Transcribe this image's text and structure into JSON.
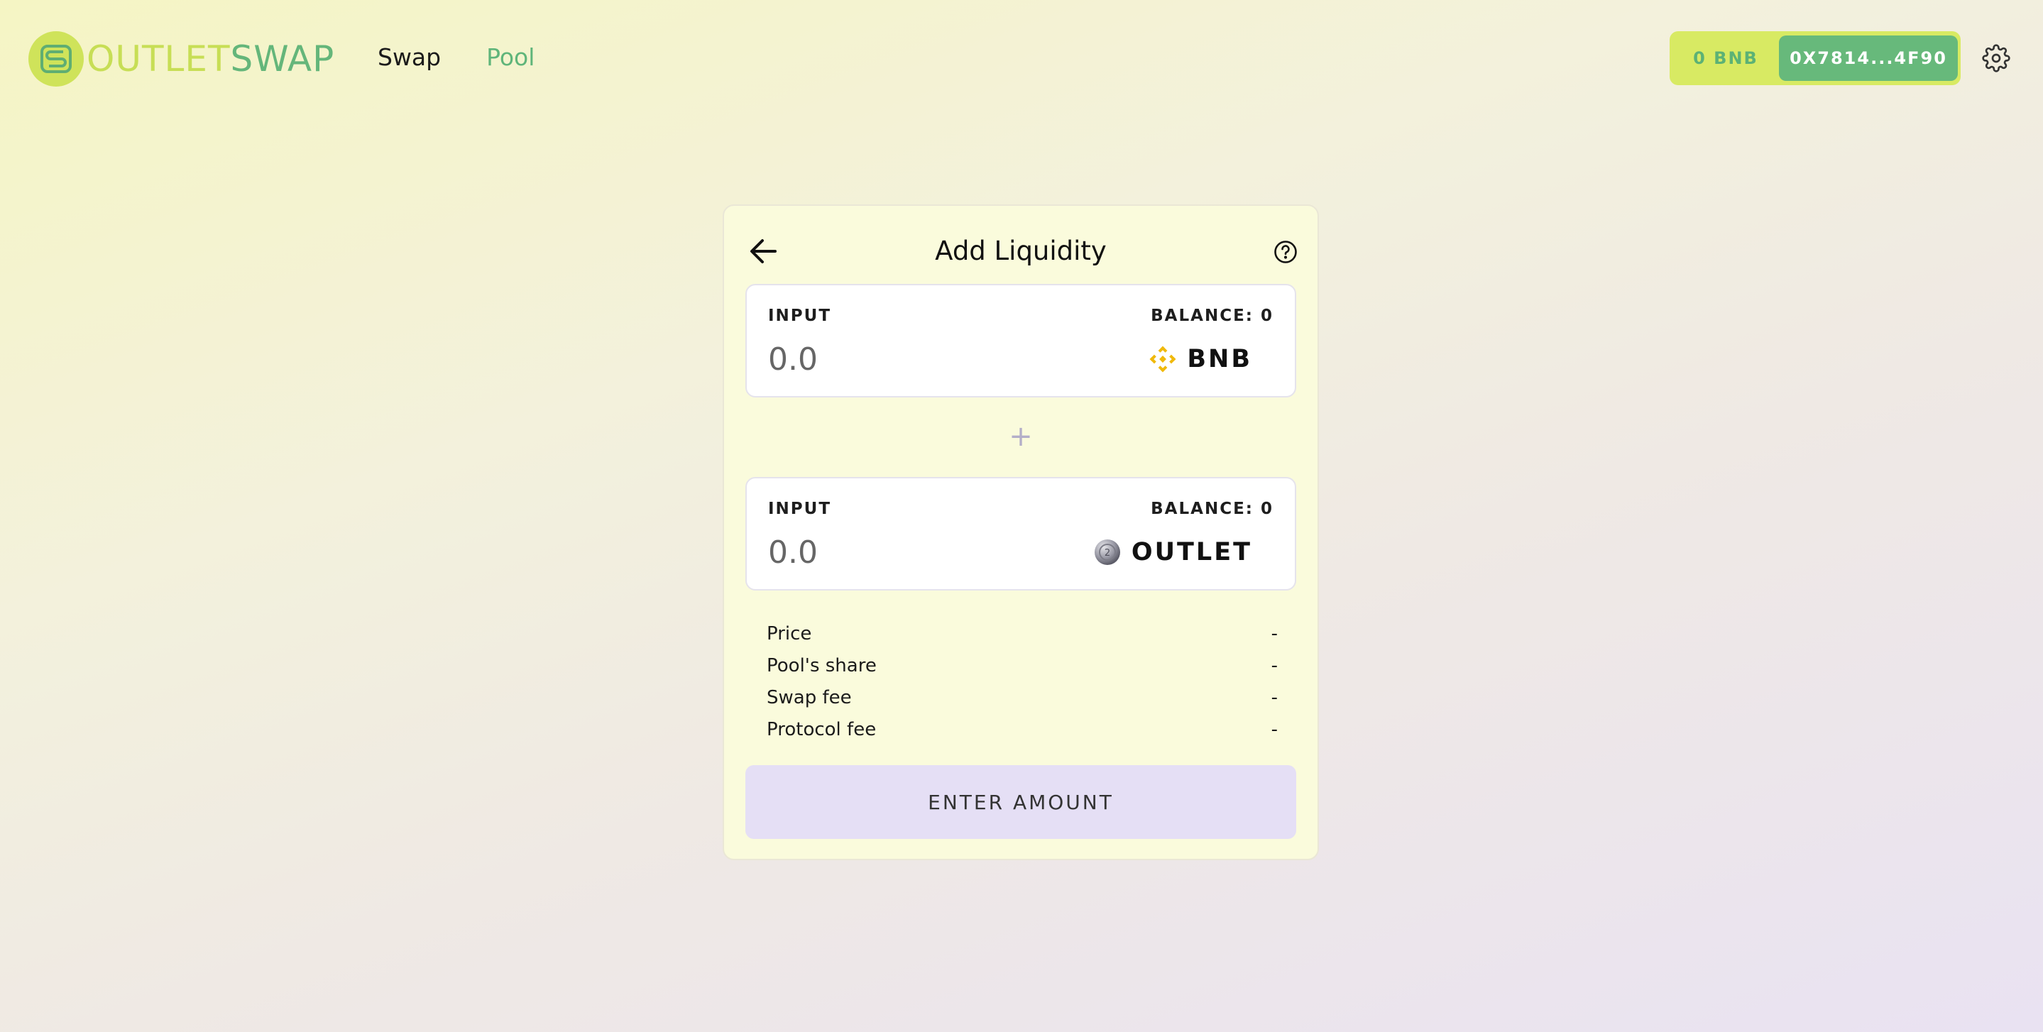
{
  "brand": {
    "part1": "OUTLET",
    "part2": "SWAP"
  },
  "nav": {
    "swap": "Swap",
    "pool": "Pool"
  },
  "wallet": {
    "balance": "0 BNB",
    "address": "0X7814...4F90"
  },
  "card": {
    "title": "Add Liquidity",
    "inputs": [
      {
        "label": "INPUT",
        "balance": "BALANCE: 0",
        "placeholder": "0.0",
        "token": "BNB",
        "token_icon": "bnb-icon"
      },
      {
        "label": "INPUT",
        "balance": "BALANCE: 0",
        "placeholder": "0.0",
        "token": "OUTLET",
        "token_icon": "outlet-token-icon"
      }
    ],
    "plus": "+",
    "stats": [
      {
        "label": "Price",
        "value": "-"
      },
      {
        "label": "Pool's share",
        "value": "-"
      },
      {
        "label": "Swap fee",
        "value": "-"
      },
      {
        "label": "Protocol fee",
        "value": "-"
      }
    ],
    "button": "ENTER AMOUNT"
  },
  "colors": {
    "accent_green": "#64b67a",
    "accent_lime": "#d8ea63",
    "card_bg": "#fafbdc",
    "button_bg": "#e5dff5"
  }
}
